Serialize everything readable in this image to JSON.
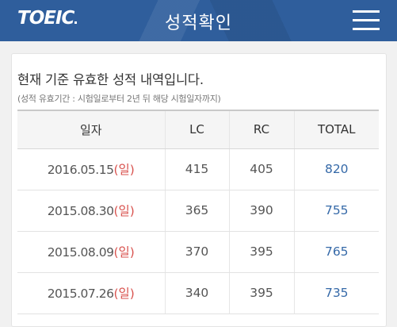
{
  "header": {
    "logo": "TOEIC",
    "title": "성적확인"
  },
  "notice": {
    "main": "현재 기준 유효한 성적 내역입니다.",
    "sub": "(성적 유효기간 : 시험일로부터 2년 뒤 해당 시험일자까지)"
  },
  "table": {
    "headers": [
      "일자",
      "LC",
      "RC",
      "TOTAL"
    ],
    "rows": [
      {
        "date": "2016.05.15",
        "day": "(일)",
        "lc": "415",
        "rc": "405",
        "total": "820"
      },
      {
        "date": "2015.08.30",
        "day": "(일)",
        "lc": "365",
        "rc": "390",
        "total": "755"
      },
      {
        "date": "2015.08.09",
        "day": "(일)",
        "lc": "370",
        "rc": "395",
        "total": "765"
      },
      {
        "date": "2015.07.26",
        "day": "(일)",
        "lc": "340",
        "rc": "395",
        "total": "735"
      }
    ]
  },
  "colors": {
    "header_bg": "#2f5e9c",
    "total_text": "#3569a8",
    "day_text": "#d9534f"
  }
}
